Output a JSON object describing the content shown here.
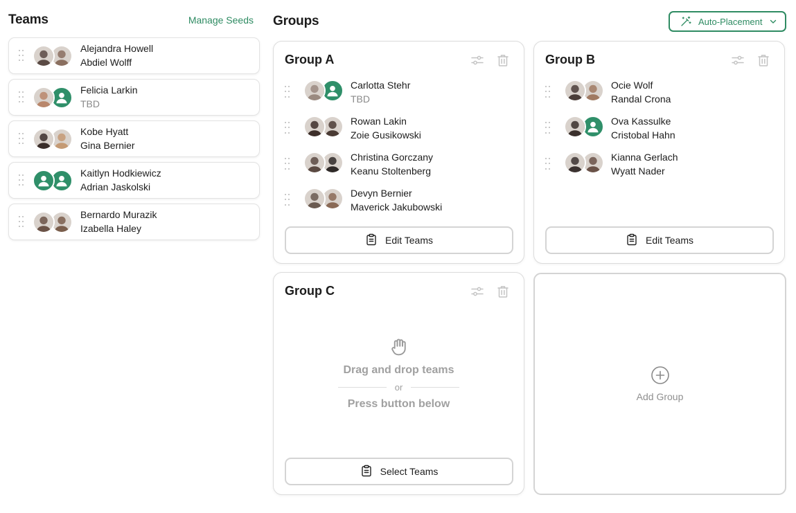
{
  "teams": {
    "title": "Teams",
    "manage_link": "Manage Seeds",
    "cards": [
      {
        "line1": "Alejandra Howell",
        "line2": "Abdiel Wolff",
        "line2_tbd": false,
        "avatar1": {
          "kind": "photo",
          "bg": "#5a4a44"
        },
        "avatar2": {
          "kind": "photo",
          "bg": "#8a6f5f"
        }
      },
      {
        "line1": "Felicia Larkin",
        "line2": "TBD",
        "line2_tbd": true,
        "avatar1": {
          "kind": "photo",
          "bg": "#b9876b"
        },
        "avatar2": {
          "kind": "placeholder"
        }
      },
      {
        "line1": "Kobe Hyatt",
        "line2": "Gina Bernier",
        "line2_tbd": false,
        "avatar1": {
          "kind": "photo",
          "bg": "#3a2e2a"
        },
        "avatar2": {
          "kind": "photo",
          "bg": "#c49a74"
        }
      },
      {
        "line1": "Kaitlyn Hodkiewicz",
        "line2": "Adrian Jaskolski",
        "line2_tbd": false,
        "avatar1": {
          "kind": "placeholder"
        },
        "avatar2": {
          "kind": "placeholder"
        }
      },
      {
        "line1": "Bernardo Murazik",
        "line2": "Izabella Haley",
        "line2_tbd": false,
        "avatar1": {
          "kind": "photo",
          "bg": "#6b5347"
        },
        "avatar2": {
          "kind": "photo",
          "bg": "#7a5e4c"
        }
      }
    ]
  },
  "groups": {
    "title": "Groups",
    "auto_placement_label": "Auto-Placement",
    "items": [
      {
        "name": "Group A",
        "button_label": "Edit Teams",
        "entries": [
          {
            "line1": "Carlotta Stehr",
            "line2": "TBD",
            "line2_tbd": true,
            "avatar1": {
              "kind": "photo",
              "bg": "#9a8a80"
            },
            "avatar2": {
              "kind": "placeholder"
            }
          },
          {
            "line1": "Rowan Lakin",
            "line2": "Zoie Gusikowski",
            "line2_tbd": false,
            "avatar1": {
              "kind": "photo",
              "bg": "#3d2f2a"
            },
            "avatar2": {
              "kind": "photo",
              "bg": "#4a3b34"
            }
          },
          {
            "line1": "Christina Gorczany",
            "line2": "Keanu Stoltenberg",
            "line2_tbd": false,
            "avatar1": {
              "kind": "photo",
              "bg": "#5b4a42"
            },
            "avatar2": {
              "kind": "photo",
              "bg": "#2f2a28"
            }
          },
          {
            "line1": "Devyn Bernier",
            "line2": "Maverick Jakubowski",
            "line2_tbd": false,
            "avatar1": {
              "kind": "photo",
              "bg": "#6a5a50"
            },
            "avatar2": {
              "kind": "photo",
              "bg": "#8a6a56"
            }
          }
        ]
      },
      {
        "name": "Group B",
        "button_label": "Edit Teams",
        "entries": [
          {
            "line1": "Ocie Wolf",
            "line2": "Randal Crona",
            "line2_tbd": false,
            "avatar1": {
              "kind": "photo",
              "bg": "#4a3d38"
            },
            "avatar2": {
              "kind": "photo",
              "bg": "#a07a62"
            }
          },
          {
            "line1": "Ova Kassulke",
            "line2": "Cristobal Hahn",
            "line2_tbd": false,
            "avatar1": {
              "kind": "photo",
              "bg": "#3a302c"
            },
            "avatar2": {
              "kind": "placeholder"
            }
          },
          {
            "line1": "Kianna Gerlach",
            "line2": "Wyatt Nader",
            "line2_tbd": false,
            "avatar1": {
              "kind": "photo",
              "bg": "#3b3230"
            },
            "avatar2": {
              "kind": "photo",
              "bg": "#6a5248"
            }
          }
        ]
      },
      {
        "name": "Group C",
        "button_label": "Select Teams",
        "entries": [],
        "empty_line1": "Drag and drop teams",
        "empty_or": "or",
        "empty_line2": "Press button below"
      }
    ],
    "add_group_label": "Add Group"
  },
  "colors": {
    "accent": "#2e8b62",
    "placeholder_avatar": "#2f8f69",
    "muted_text": "#8a8a8a",
    "border": "#dcdcdc"
  },
  "icons": [
    "drag-handle-icon",
    "person-icon",
    "wand-icon",
    "chevron-down-icon",
    "sliders-icon",
    "trash-icon",
    "clipboard-icon",
    "hand-icon",
    "plus-circle-icon"
  ]
}
